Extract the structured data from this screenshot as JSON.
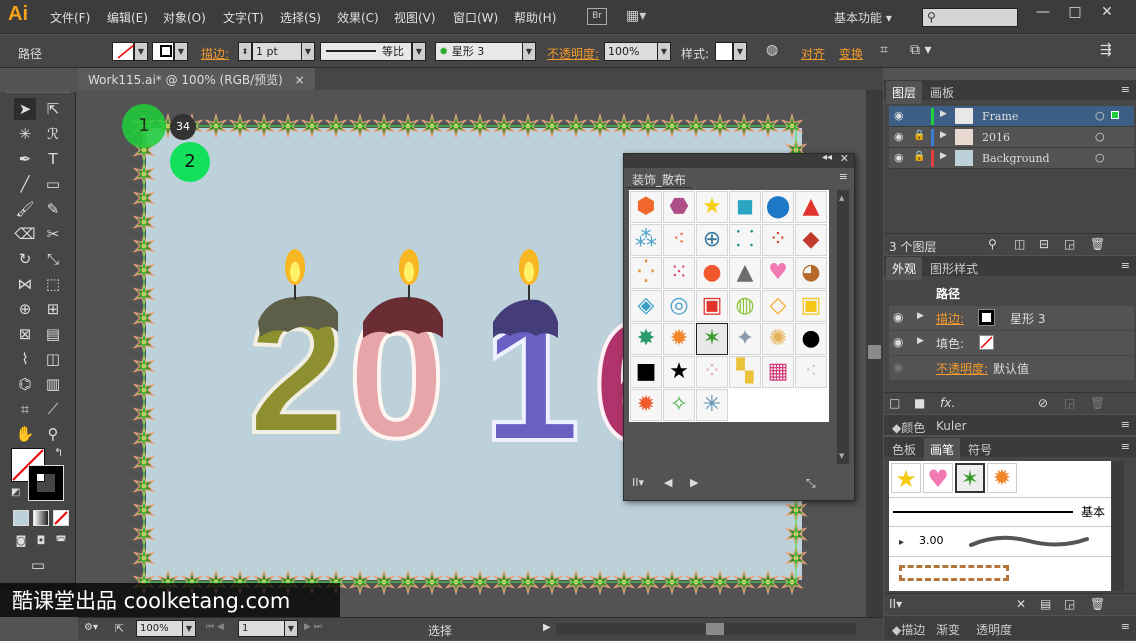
{
  "app": {
    "logo": "Ai"
  },
  "menu": [
    "文件(F)",
    "编辑(E)",
    "对象(O)",
    "文字(T)",
    "选择(S)",
    "效果(C)",
    "视图(V)",
    "窗口(W)",
    "帮助(H)"
  ],
  "menubar": {
    "br_label": "Br",
    "workspace": "基本功能",
    "window_controls": [
      "—",
      "□",
      "✕"
    ]
  },
  "control": {
    "object_type": "路径",
    "stroke_label": "描边:",
    "stroke_weight": "1 pt",
    "profile_label": "等比",
    "brush_name": "星形 3",
    "opacity_label": "不透明度:",
    "opacity_value": "100%",
    "style_label": "样式:",
    "align_label": "对齐",
    "transform_label": "变换"
  },
  "document": {
    "tab_title": "Work115.ai* @ 100% (RGB/预览)"
  },
  "canvas": {
    "year_text": "2016"
  },
  "badges": {
    "one": "1",
    "two": "2",
    "count": "34"
  },
  "status": {
    "zoom": "100%",
    "page": "1",
    "tool": "选择"
  },
  "layers_panel": {
    "tabs": [
      "图层",
      "画板"
    ],
    "layers": [
      {
        "name": "Frame",
        "color": "#1fcf3a",
        "selected": true
      },
      {
        "name": "2016",
        "color": "#3d7bd9",
        "selected": false
      },
      {
        "name": "Background",
        "color": "#e24040",
        "selected": false
      }
    ],
    "footer": "3 个图层"
  },
  "appearance_panel": {
    "tabs": [
      "外观",
      "图形样式"
    ],
    "title": "路径",
    "stroke_label": "描边:",
    "stroke_value": "星形 3",
    "fill_label": "填色:",
    "opacity_label": "不透明度:",
    "opacity_value": "默认值"
  },
  "color_tabs": [
    "颜色",
    "Kuler"
  ],
  "brushes_panel": {
    "tabs": [
      "色板",
      "画笔",
      "符号"
    ],
    "basic_label": "基本",
    "size_label": "3.00"
  },
  "bottom_tabs": [
    "描边",
    "渐变",
    "透明度"
  ],
  "symbol_panel": {
    "title": "装饰_散布"
  },
  "watermark": "酷课堂出品 coolketang.com",
  "colors": {
    "accent": "#f29a2e",
    "frame_green": "#1fcf3a",
    "artboard": "#bcd1da"
  }
}
